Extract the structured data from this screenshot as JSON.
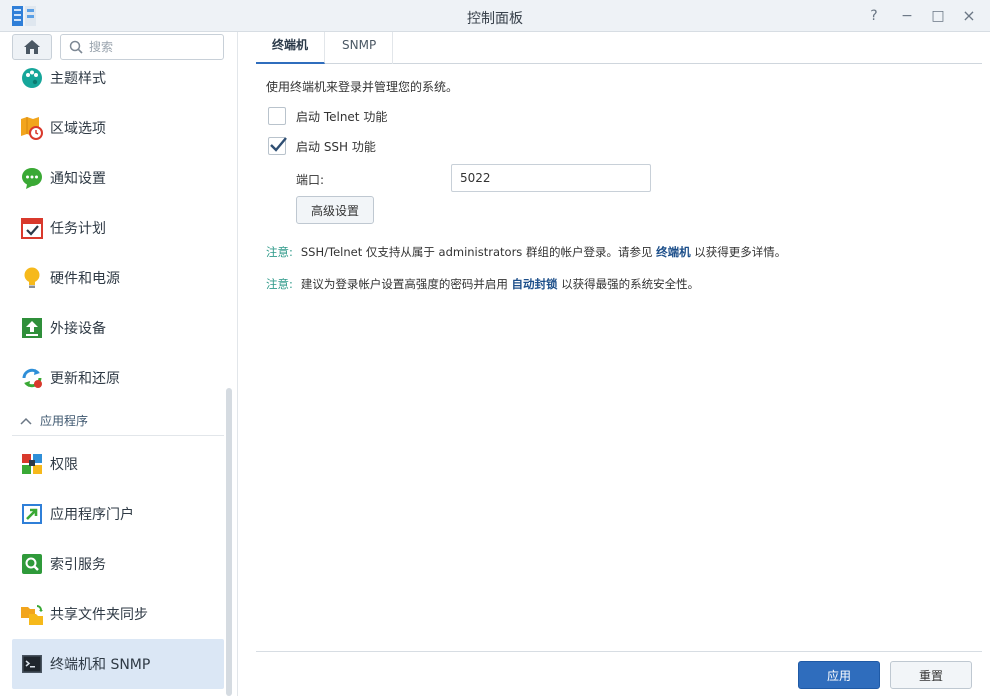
{
  "window": {
    "title": "控制面板",
    "buttons": [
      "?",
      "−",
      "□",
      "×"
    ]
  },
  "sidebar": {
    "search": {
      "placeholder": "搜索"
    },
    "items": [
      {
        "label": "主题样式",
        "icon": "palette-icon"
      },
      {
        "label": "区域选项",
        "icon": "map-clock-icon"
      },
      {
        "label": "通知设置",
        "icon": "chat-bubble-icon"
      },
      {
        "label": "任务计划",
        "icon": "calendar-check-icon"
      },
      {
        "label": "硬件和电源",
        "icon": "lightbulb-icon"
      },
      {
        "label": "外接设备",
        "icon": "upload-device-icon"
      },
      {
        "label": "更新和还原",
        "icon": "refresh-icon"
      },
      {
        "label": "权限",
        "icon": "permission-blocks-icon"
      },
      {
        "label": "应用程序门户",
        "icon": "portal-arrow-icon"
      },
      {
        "label": "索引服务",
        "icon": "search-index-icon"
      },
      {
        "label": "共享文件夹同步",
        "icon": "folder-sync-icon"
      },
      {
        "label": "终端机和 SNMP",
        "icon": "terminal-icon"
      }
    ],
    "section": {
      "label": "应用程序"
    }
  },
  "tabs": [
    {
      "label": "终端机",
      "active": true
    },
    {
      "label": "SNMP",
      "active": false
    }
  ],
  "content": {
    "description": "使用终端机来登录并管理您的系统。",
    "telnet": {
      "label": "启动 Telnet 功能",
      "checked": false
    },
    "ssh": {
      "label": "启动 SSH 功能",
      "checked": true
    },
    "port": {
      "label": "端口:",
      "value": "5022"
    },
    "advanced_button": "高级设置",
    "note1": {
      "tag": "注意:",
      "text_a": "SSH/Telnet 仅支持从属于 administrators 群组的帐户登录。请参见",
      "link": "终端机",
      "text_b": "以获得更多详情。"
    },
    "note2": {
      "tag": "注意:",
      "text_a": "建议为登录帐户设置高强度的密码并启用",
      "link": "自动封锁",
      "text_b": "以获得最强的系统安全性。"
    }
  },
  "footer": {
    "apply": "应用",
    "reset": "重置"
  },
  "colors": {
    "accent": "#2f6dbd",
    "active_bg": "#dbe7f5",
    "note_tag": "#2f9a8a",
    "link": "#1d4f8a"
  }
}
